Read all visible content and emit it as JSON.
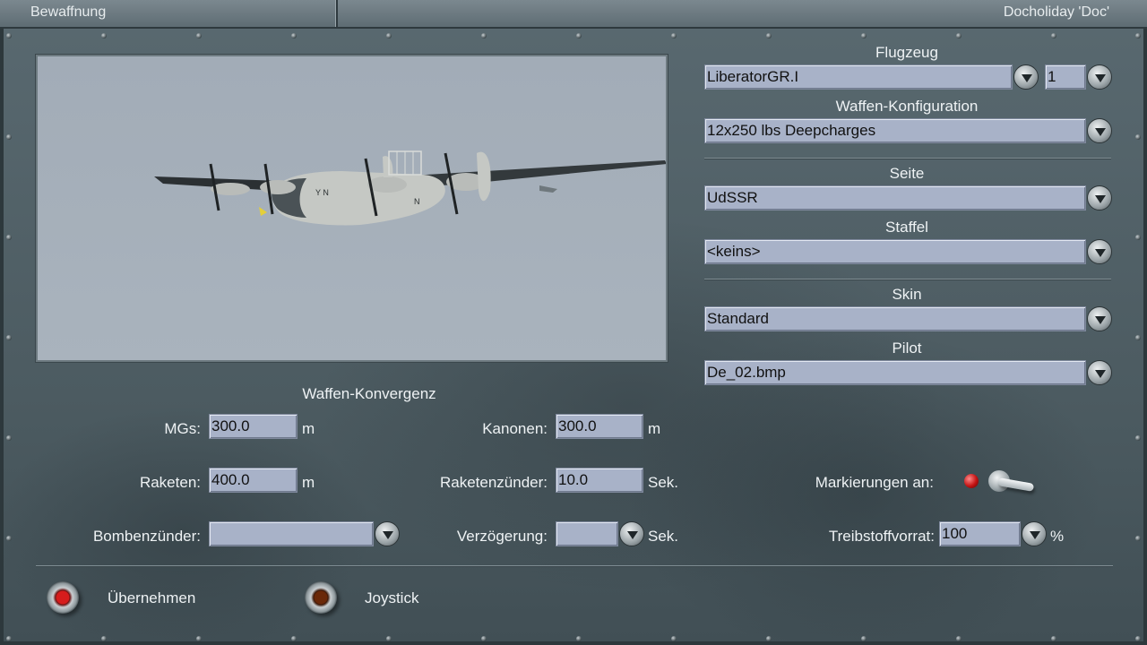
{
  "header": {
    "section_title": "Bewaffnung",
    "user_name": "Docholiday 'Doc'"
  },
  "aircraft": {
    "label": "Flugzeug",
    "value": "LiberatorGR.I",
    "count": "1"
  },
  "weapons": {
    "label": "Waffen-Konfiguration",
    "value": "12x250 lbs Deepcharges"
  },
  "side": {
    "label": "Seite",
    "value": "UdSSR"
  },
  "squadron": {
    "label": "Staffel",
    "value": "<keins>"
  },
  "skin": {
    "label": "Skin",
    "value": "Standard"
  },
  "pilot": {
    "label": "Pilot",
    "value": "De_02.bmp"
  },
  "convergence": {
    "title": "Waffen-Konvergenz",
    "mgs": {
      "label": "MGs:",
      "value": "300.0",
      "unit": "m"
    },
    "cannons": {
      "label": "Kanonen:",
      "value": "300.0",
      "unit": "m"
    },
    "rockets": {
      "label": "Raketen:",
      "value": "400.0",
      "unit": "m"
    },
    "rocket_fuse": {
      "label": "Raketenzünder:",
      "value": "10.0",
      "unit": "Sek."
    },
    "bomb_fuse": {
      "label": "Bombenzünder:",
      "value": ""
    },
    "delay": {
      "label": "Verzögerung:",
      "value": "",
      "unit": "Sek."
    }
  },
  "markers": {
    "label": "Markierungen an:",
    "state": "on"
  },
  "fuel": {
    "label": "Treibstoffvorrat:",
    "value": "100",
    "unit": "%"
  },
  "buttons": {
    "apply": "Übernehmen",
    "joystick": "Joystick"
  },
  "colors": {
    "panel": "#4f5f66",
    "field": "#a8b2c8",
    "text": "#eef2f4",
    "preview_sky": "#a6b0ba"
  }
}
